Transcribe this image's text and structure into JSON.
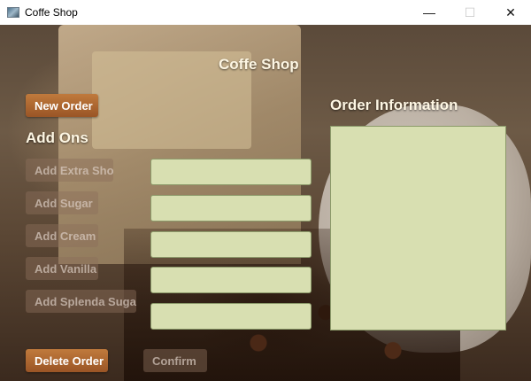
{
  "window": {
    "title": "Coffe Shop",
    "controls": {
      "minimize": "—",
      "maximize": "☐",
      "close": "✕"
    }
  },
  "main": {
    "app_title": "Coffe Shop",
    "add_ons_heading": "Add Ons",
    "order_info_heading": "Order Information"
  },
  "buttons": {
    "new_order": "New Order",
    "add_extra_shot": "Add Extra Shot",
    "add_sugar": "Add Sugar",
    "add_cream": "Add Cream",
    "add_vanilla": "Add Vanilla",
    "add_splenda_sugar": "Add Splenda Sugar",
    "delete_order": "Delete Order",
    "confirm": "Confirm"
  },
  "fields": {
    "extra_shot": "",
    "sugar": "",
    "cream": "",
    "vanilla": "",
    "splenda_sugar": "",
    "order_info": ""
  },
  "colors": {
    "accent_button": "#b0683a",
    "field_background": "#d8dfb1",
    "heading_text": "#fdf6e3"
  },
  "icons": {
    "app": "coffee-app-icon"
  }
}
